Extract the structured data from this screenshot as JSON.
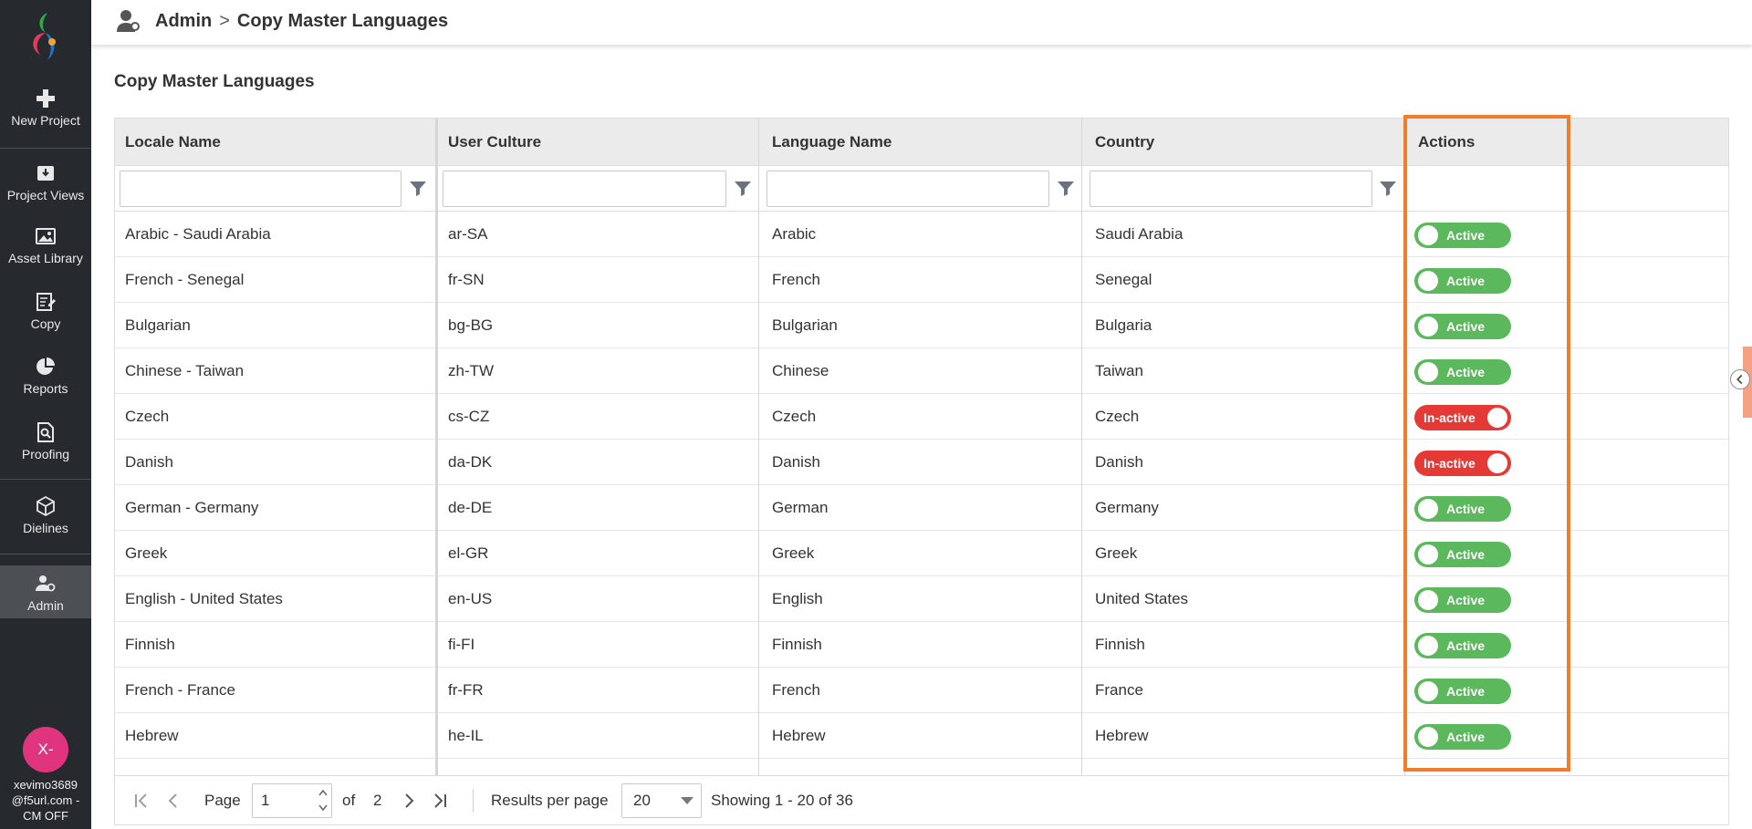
{
  "sidebar": {
    "items": [
      {
        "label": "New Project",
        "icon": "plus-icon"
      },
      {
        "label": "Project Views",
        "icon": "download-box-icon"
      },
      {
        "label": "Asset Library",
        "icon": "image-icon"
      },
      {
        "label": "Copy",
        "icon": "edit-document-icon"
      },
      {
        "label": "Reports",
        "icon": "pie-chart-icon"
      },
      {
        "label": "Proofing",
        "icon": "search-document-icon"
      },
      {
        "label": "Dielines",
        "icon": "box-3d-icon"
      },
      {
        "label": "Admin",
        "icon": "admin-user-icon"
      }
    ],
    "avatar_initials": "X-",
    "user_line1": "xevimo3689",
    "user_line2": "@f5url.com -",
    "user_line3": "CM OFF"
  },
  "breadcrumb": {
    "root": "Admin",
    "separator": ">",
    "current": "Copy Master Languages"
  },
  "page_title": "Copy Master Languages",
  "table": {
    "columns": [
      "Locale Name",
      "User Culture",
      "Language Name",
      "Country",
      "Actions"
    ],
    "rows": [
      {
        "locale": "Arabic - Saudi Arabia",
        "culture": "ar-SA",
        "language": "Arabic",
        "country": "Saudi Arabia",
        "status": "Active"
      },
      {
        "locale": "French - Senegal",
        "culture": "fr-SN",
        "language": "French",
        "country": "Senegal",
        "status": "Active"
      },
      {
        "locale": "Bulgarian",
        "culture": "bg-BG",
        "language": "Bulgarian",
        "country": "Bulgaria",
        "status": "Active"
      },
      {
        "locale": "Chinese - Taiwan",
        "culture": "zh-TW",
        "language": "Chinese",
        "country": "Taiwan",
        "status": "Active"
      },
      {
        "locale": "Czech",
        "culture": "cs-CZ",
        "language": "Czech",
        "country": "Czech",
        "status": "In-active"
      },
      {
        "locale": "Danish",
        "culture": "da-DK",
        "language": "Danish",
        "country": "Danish",
        "status": "In-active"
      },
      {
        "locale": "German - Germany",
        "culture": "de-DE",
        "language": "German",
        "country": "Germany",
        "status": "Active"
      },
      {
        "locale": "Greek",
        "culture": "el-GR",
        "language": "Greek",
        "country": "Greek",
        "status": "Active"
      },
      {
        "locale": "English - United States",
        "culture": "en-US",
        "language": "English",
        "country": "United States",
        "status": "Active"
      },
      {
        "locale": "Finnish",
        "culture": "fi-FI",
        "language": "Finnish",
        "country": "Finnish",
        "status": "Active"
      },
      {
        "locale": "French - France",
        "culture": "fr-FR",
        "language": "French",
        "country": "France",
        "status": "Active"
      },
      {
        "locale": "Hebrew",
        "culture": "he-IL",
        "language": "Hebrew",
        "country": "Hebrew",
        "status": "Active"
      }
    ]
  },
  "pager": {
    "page_label": "Page",
    "page_value": "1",
    "of_label": "of",
    "total_pages": "2",
    "results_label": "Results per page",
    "per_page": "20",
    "showing": "Showing 1 - 20 of 36"
  },
  "colors": {
    "active": "#5cb85c",
    "inactive": "#e53935",
    "highlight": "#f07d2b",
    "sidebar": "#262a2e",
    "avatar": "#e0347f"
  }
}
